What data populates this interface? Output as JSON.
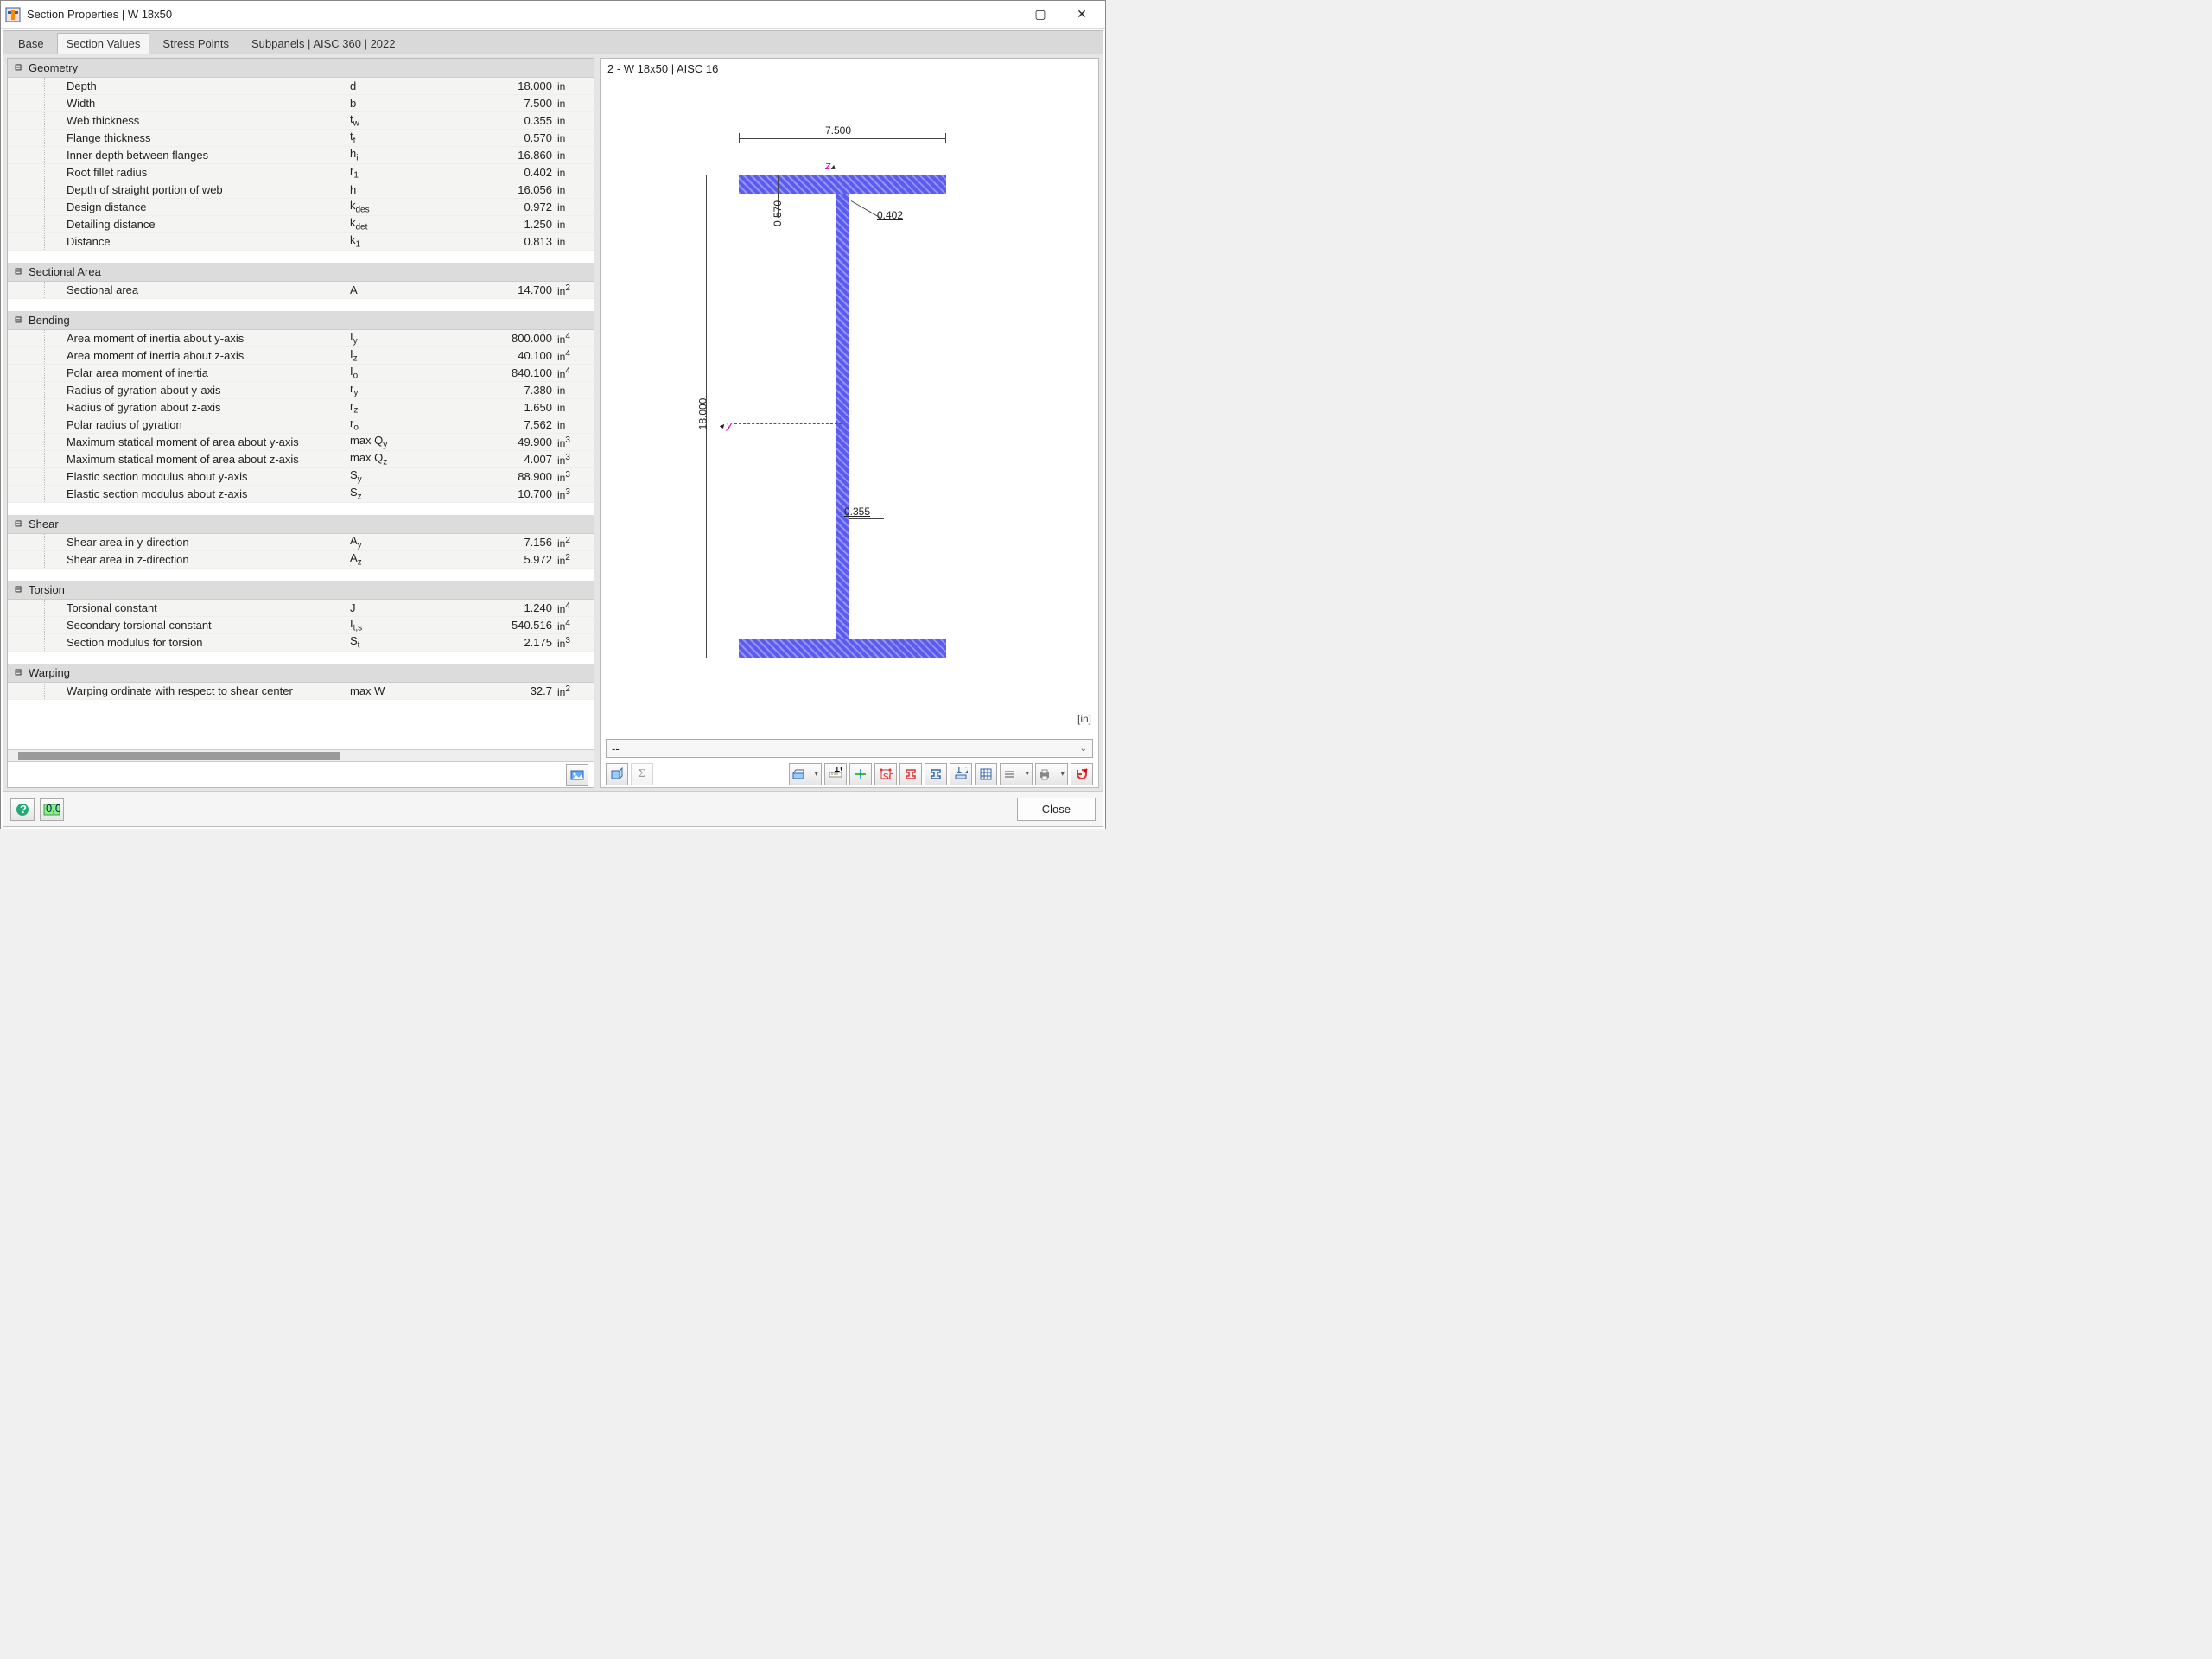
{
  "window": {
    "title": "Section Properties | W 18x50"
  },
  "tabs": [
    "Base",
    "Section Values",
    "Stress Points",
    "Subpanels | AISC 360 | 2022"
  ],
  "active_tab": 1,
  "categories": [
    {
      "name": "Geometry",
      "rows": [
        {
          "label": "Depth",
          "sym": "d",
          "value": "18.000",
          "unit": "in"
        },
        {
          "label": "Width",
          "sym": "b",
          "value": "7.500",
          "unit": "in"
        },
        {
          "label": "Web thickness",
          "sym": "t<sub>w</sub>",
          "value": "0.355",
          "unit": "in"
        },
        {
          "label": "Flange thickness",
          "sym": "t<sub>f</sub>",
          "value": "0.570",
          "unit": "in"
        },
        {
          "label": "Inner depth between flanges",
          "sym": "h<sub>i</sub>",
          "value": "16.860",
          "unit": "in"
        },
        {
          "label": "Root fillet radius",
          "sym": "r<sub>1</sub>",
          "value": "0.402",
          "unit": "in"
        },
        {
          "label": "Depth of straight portion of web",
          "sym": "h",
          "value": "16.056",
          "unit": "in"
        },
        {
          "label": "Design distance",
          "sym": "k<sub>des</sub>",
          "value": "0.972",
          "unit": "in"
        },
        {
          "label": "Detailing distance",
          "sym": "k<sub>det</sub>",
          "value": "1.250",
          "unit": "in"
        },
        {
          "label": "Distance",
          "sym": "k<sub>1</sub>",
          "value": "0.813",
          "unit": "in"
        }
      ]
    },
    {
      "name": "Sectional Area",
      "rows": [
        {
          "label": "Sectional area",
          "sym": "A",
          "value": "14.700",
          "unit": "in<sup>2</sup>"
        }
      ]
    },
    {
      "name": "Bending",
      "rows": [
        {
          "label": "Area moment of inertia about y-axis",
          "sym": "I<sub>y</sub>",
          "value": "800.000",
          "unit": "in<sup>4</sup>"
        },
        {
          "label": "Area moment of inertia about z-axis",
          "sym": "I<sub>z</sub>",
          "value": "40.100",
          "unit": "in<sup>4</sup>"
        },
        {
          "label": "Polar area moment of inertia",
          "sym": "I<sub>o</sub>",
          "value": "840.100",
          "unit": "in<sup>4</sup>"
        },
        {
          "label": "Radius of gyration about y-axis",
          "sym": "r<sub>y</sub>",
          "value": "7.380",
          "unit": "in"
        },
        {
          "label": "Radius of gyration about z-axis",
          "sym": "r<sub>z</sub>",
          "value": "1.650",
          "unit": "in"
        },
        {
          "label": "Polar radius of gyration",
          "sym": "r<sub>o</sub>",
          "value": "7.562",
          "unit": "in"
        },
        {
          "label": "Maximum statical moment of area about y-axis",
          "sym": "max Q<sub>y</sub>",
          "value": "49.900",
          "unit": "in<sup>3</sup>"
        },
        {
          "label": "Maximum statical moment of area about z-axis",
          "sym": "max Q<sub>z</sub>",
          "value": "4.007",
          "unit": "in<sup>3</sup>"
        },
        {
          "label": "Elastic section modulus about y-axis",
          "sym": "S<sub>y</sub>",
          "value": "88.900",
          "unit": "in<sup>3</sup>"
        },
        {
          "label": "Elastic section modulus about z-axis",
          "sym": "S<sub>z</sub>",
          "value": "10.700",
          "unit": "in<sup>3</sup>"
        }
      ]
    },
    {
      "name": "Shear",
      "rows": [
        {
          "label": "Shear area in y-direction",
          "sym": "A<sub>y</sub>",
          "value": "7.156",
          "unit": "in<sup>2</sup>"
        },
        {
          "label": "Shear area in z-direction",
          "sym": "A<sub>z</sub>",
          "value": "5.972",
          "unit": "in<sup>2</sup>"
        }
      ]
    },
    {
      "name": "Torsion",
      "rows": [
        {
          "label": "Torsional constant",
          "sym": "J",
          "value": "1.240",
          "unit": "in<sup>4</sup>"
        },
        {
          "label": "Secondary torsional constant",
          "sym": "I<sub>t,s</sub>",
          "value": "540.516",
          "unit": "in<sup>4</sup>"
        },
        {
          "label": "Section modulus for torsion",
          "sym": "S<sub>t</sub>",
          "value": "2.175",
          "unit": "in<sup>3</sup>"
        }
      ]
    },
    {
      "name": "Warping",
      "rows": [
        {
          "label": "Warping ordinate with respect to shear center",
          "sym": "max W",
          "value": "32.7",
          "unit": "in<sup>2</sup>"
        }
      ]
    }
  ],
  "viewer": {
    "header": "2 - W 18x50 | AISC 16",
    "units": "[in]",
    "dims": {
      "depth": "18.000",
      "width": "7.500",
      "tf": "0.570",
      "tw": "0.355",
      "r": "0.402"
    }
  },
  "dropdown": "--",
  "footer": {
    "close": "Close"
  }
}
